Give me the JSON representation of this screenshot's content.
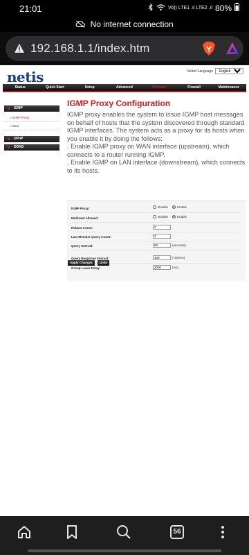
{
  "status_bar": {
    "time": "21:01",
    "network": "Vo)) LTE1 .ıl LTE2 .ıl",
    "battery": "80%"
  },
  "connection_banner": "No internet connection",
  "browser": {
    "url": "192.168.1.1/index.htm",
    "tab_count": "56"
  },
  "router": {
    "logo": "netis",
    "select_language_label": "Select Language",
    "language_value": "English",
    "top_nav": [
      "Status",
      "Quick Start",
      "Setup",
      "Advanced",
      "Network",
      "Firewall",
      "Maintenance"
    ],
    "sidebar": {
      "igmp_header": "IGMP",
      "igmp_items": [
        "IGMP Proxy",
        "MLD"
      ],
      "upnp_header": "UPnP",
      "ddns_header": "DDNS"
    },
    "title": "IGMP Proxy Configuration",
    "description": [
      "IGMP proxy enables the system to issue IGMP host messages on behalf of hosts that the system discovered through standard IGMP interfaces. The system acts as a proxy for its hosts when you enable it by doing the follows:",
      ". Enable IGMP proxy on WAN interface (upstream), which connects to a router running IGMP.",
      ". Enable IGMP on LAN interface (downstream), which connects to its hosts."
    ],
    "form": {
      "igmp_proxy_label": "IGMP Proxy:",
      "multicast_label": "Multicast Allowed:",
      "disable_label": "Disable",
      "enable_label": "Enable",
      "robust_count_label": "Robust Count:",
      "robust_count_value": "2",
      "last_member_label": "Last Member Query Count:",
      "last_member_value": "2",
      "query_interval_label": "Query Interval:",
      "query_interval_value": "60",
      "query_interval_unit": "(seconds)",
      "query_response_label": "Query Response Interval:",
      "query_response_value": "100",
      "query_response_unit": "(*100ms)",
      "group_leave_label": "Group Leave Delay:",
      "group_leave_value": "2000",
      "group_leave_unit": "(ms)"
    },
    "buttons": {
      "apply": "Apply Changes",
      "undo": "Undo"
    }
  }
}
